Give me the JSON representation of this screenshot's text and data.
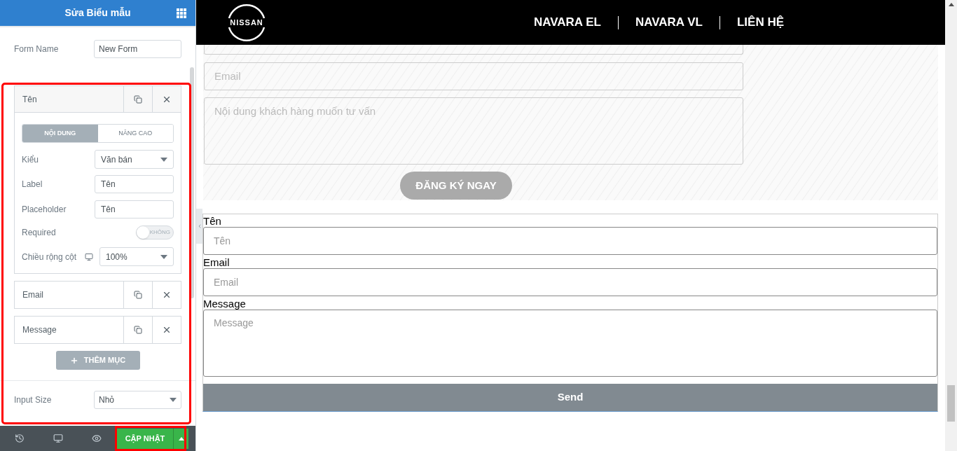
{
  "panel": {
    "title": "Sửa Biểu mẫu",
    "form_name": {
      "label": "Form Name",
      "value": "New Form"
    },
    "fields": [
      {
        "title": "Tên",
        "expanded": true,
        "tabs": [
          {
            "label": "NỘI DUNG",
            "selected": true
          },
          {
            "label": "NÂNG CAO",
            "selected": false
          }
        ],
        "settings": [
          {
            "kind": "select",
            "label": "Kiểu",
            "value": "Văn bán"
          },
          {
            "kind": "text",
            "label": "Label",
            "value": "Tên"
          },
          {
            "kind": "text",
            "label": "Placeholder",
            "value": "Tên"
          },
          {
            "kind": "toggle",
            "label": "Required",
            "on": false,
            "state_text": "KHÔNG"
          },
          {
            "kind": "select",
            "label": "Chiều rộng cột",
            "value": "100%",
            "responsive": true
          }
        ]
      },
      {
        "title": "Email",
        "expanded": false
      },
      {
        "title": "Message",
        "expanded": false
      }
    ],
    "add_button": "THÊM MỤC",
    "input_size": {
      "label": "Input Size",
      "value": "Nhỏ"
    },
    "update_button": "CẬP NHẬT"
  },
  "nav": {
    "logo": "NISSAN",
    "links": [
      "NAVARA EL",
      "NAVARA VL",
      "LIÊN HỆ"
    ]
  },
  "preview_form": {
    "email_placeholder": "Email",
    "message_placeholder": "Nội dung khách hàng muốn tư vấn",
    "submit": "ĐĂNG KÝ NGAY"
  },
  "widget_form": {
    "fields": [
      {
        "kind": "input",
        "label": "Tên",
        "placeholder": "Tên"
      },
      {
        "kind": "input",
        "label": "Email",
        "placeholder": "Email"
      },
      {
        "kind": "textarea",
        "label": "Message",
        "placeholder": "Message"
      }
    ],
    "submit": "Send"
  }
}
